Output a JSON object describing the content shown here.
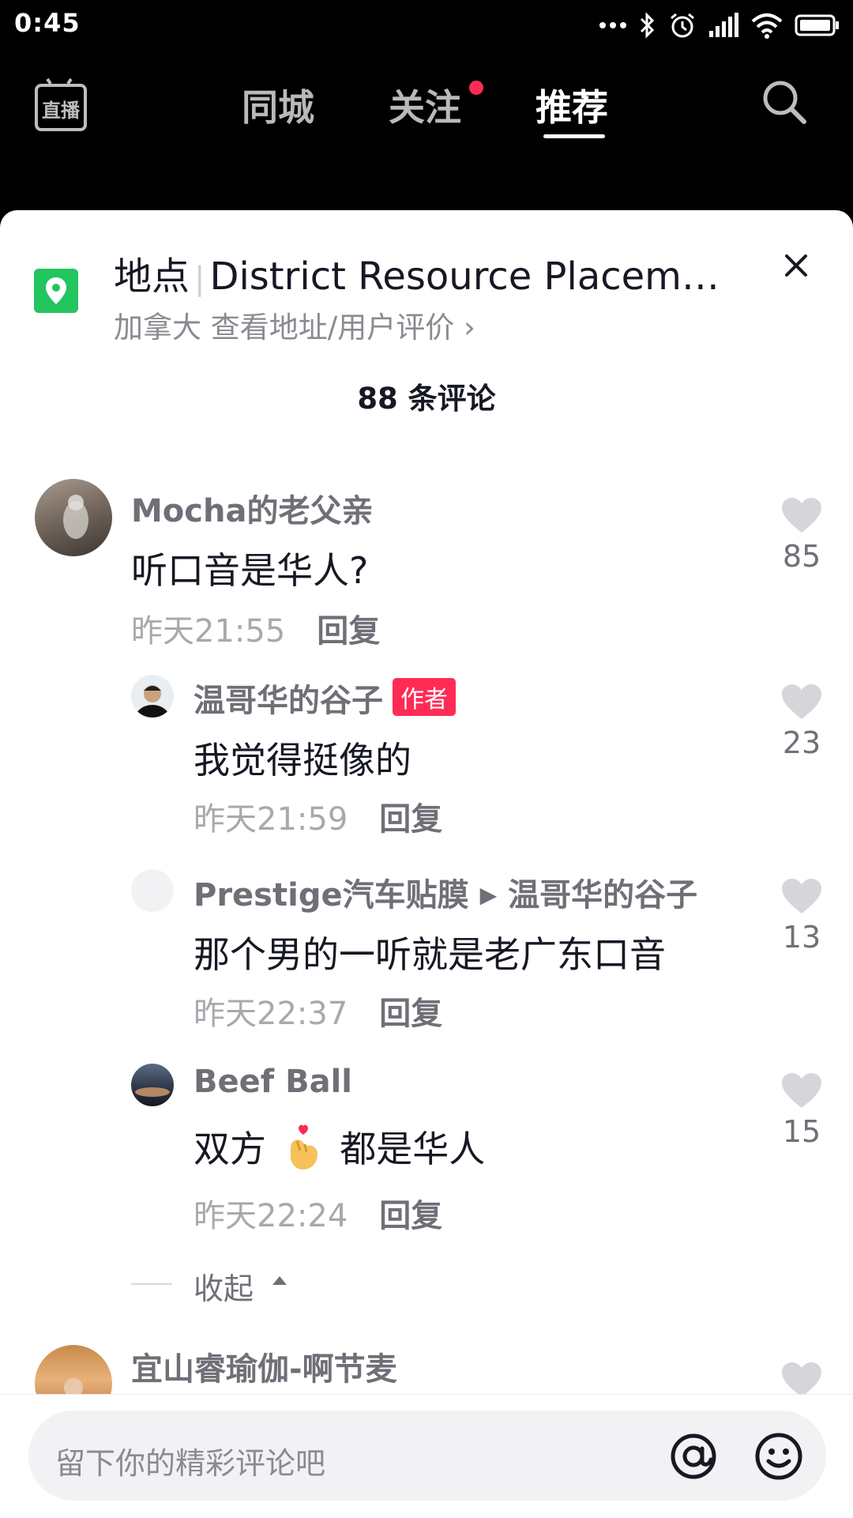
{
  "status_bar": {
    "time": "0:45"
  },
  "top_nav": {
    "tabs": [
      {
        "label": "同城"
      },
      {
        "label": "关注"
      },
      {
        "label": "推荐"
      }
    ],
    "live_icon_text": "直播"
  },
  "location": {
    "label": "地点",
    "name": "District Resource Placem…",
    "sub": "加拿大  查看地址/用户评价 ›"
  },
  "comments_header": "88 条评论",
  "comments": [
    {
      "user": "Mocha的老父亲",
      "text": "听口音是华人?",
      "time": "昨天21:55",
      "reply": "回复",
      "likes": "85"
    },
    {
      "user": "温哥华的谷子",
      "tag": "作者",
      "text": "我觉得挺像的",
      "time": "昨天21:59",
      "reply": "回复",
      "likes": "23"
    },
    {
      "user": "Prestige汽车贴膜",
      "reply_to": "温哥华的谷子",
      "text": "那个男的一听就是老广东口音",
      "time": "昨天22:37",
      "reply": "回复",
      "likes": "13"
    },
    {
      "user": "Beef Ball",
      "text_before": "双方",
      "text_after": "都是华人",
      "time": "昨天22:24",
      "reply": "回复",
      "likes": "15"
    },
    {
      "user": "宜山睿瑜伽-啊节麦"
    }
  ],
  "collapse_label": "收起",
  "input": {
    "placeholder": "留下你的精彩评论吧"
  },
  "colors": {
    "accent": "#fe2c55",
    "location_green": "#22c55e"
  }
}
